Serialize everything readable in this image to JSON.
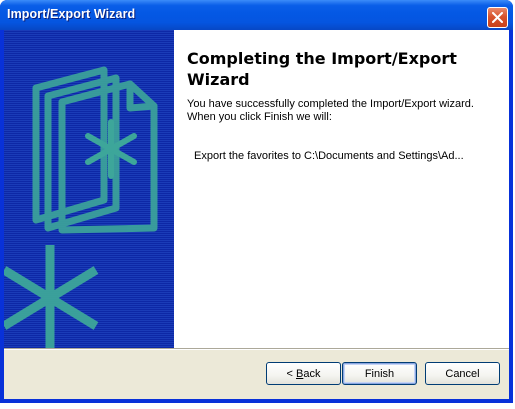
{
  "window": {
    "title": "Import/Export Wizard",
    "close_icon": "close-icon"
  },
  "wizard": {
    "heading": "Completing the Import/Export Wizard",
    "body": "You have successfully completed the Import/Export wizard.  When you click Finish we will:",
    "detail": "Export the favorites to C:\\Documents and Settings\\Ad..."
  },
  "buttons": {
    "back_label_prefix": "< ",
    "back_label_underlined": "B",
    "back_label_rest": "ack",
    "finish_label": "Finish",
    "cancel_label": "Cancel"
  },
  "colors": {
    "title_bar": "#0458e4",
    "left_panel": "#0d28a6",
    "panel_art": "#3da69a",
    "dialog_face": "#ece9d8"
  }
}
